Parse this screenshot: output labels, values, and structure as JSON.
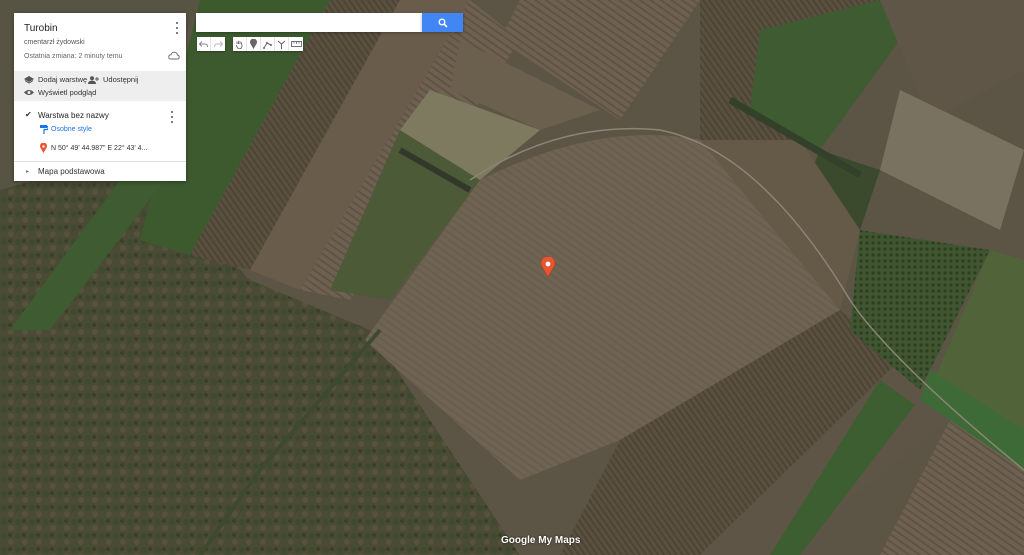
{
  "panel": {
    "title": "Turobin",
    "description": "cmentarzł żydowski",
    "last_change": "Ostatnia zmiana: 2 minuty temu",
    "add_layer_label": "Dodaj warstwę",
    "share_label": "Udostępnij",
    "preview_label": "Wyświetl podgląd",
    "layer": {
      "checked": true,
      "name": "Warstwa bez nazwy",
      "style_label": "Osobne style",
      "items": [
        {
          "label": "N 50° 49' 44.987\" E 22° 43' 4...",
          "color": "#e8542f"
        }
      ]
    },
    "basemap_label": "Mapa podstawowa"
  },
  "search": {
    "value": "",
    "placeholder": ""
  },
  "toolbar": {
    "icons": [
      "undo-icon",
      "redo-icon",
      "hand-icon",
      "marker-icon",
      "line-icon",
      "directions-icon",
      "ruler-icon"
    ]
  },
  "map": {
    "marker_color": "#e8542f",
    "logo_text": "Google My Maps"
  },
  "colors": {
    "accent": "#4285f4",
    "marker": "#e8542f"
  }
}
